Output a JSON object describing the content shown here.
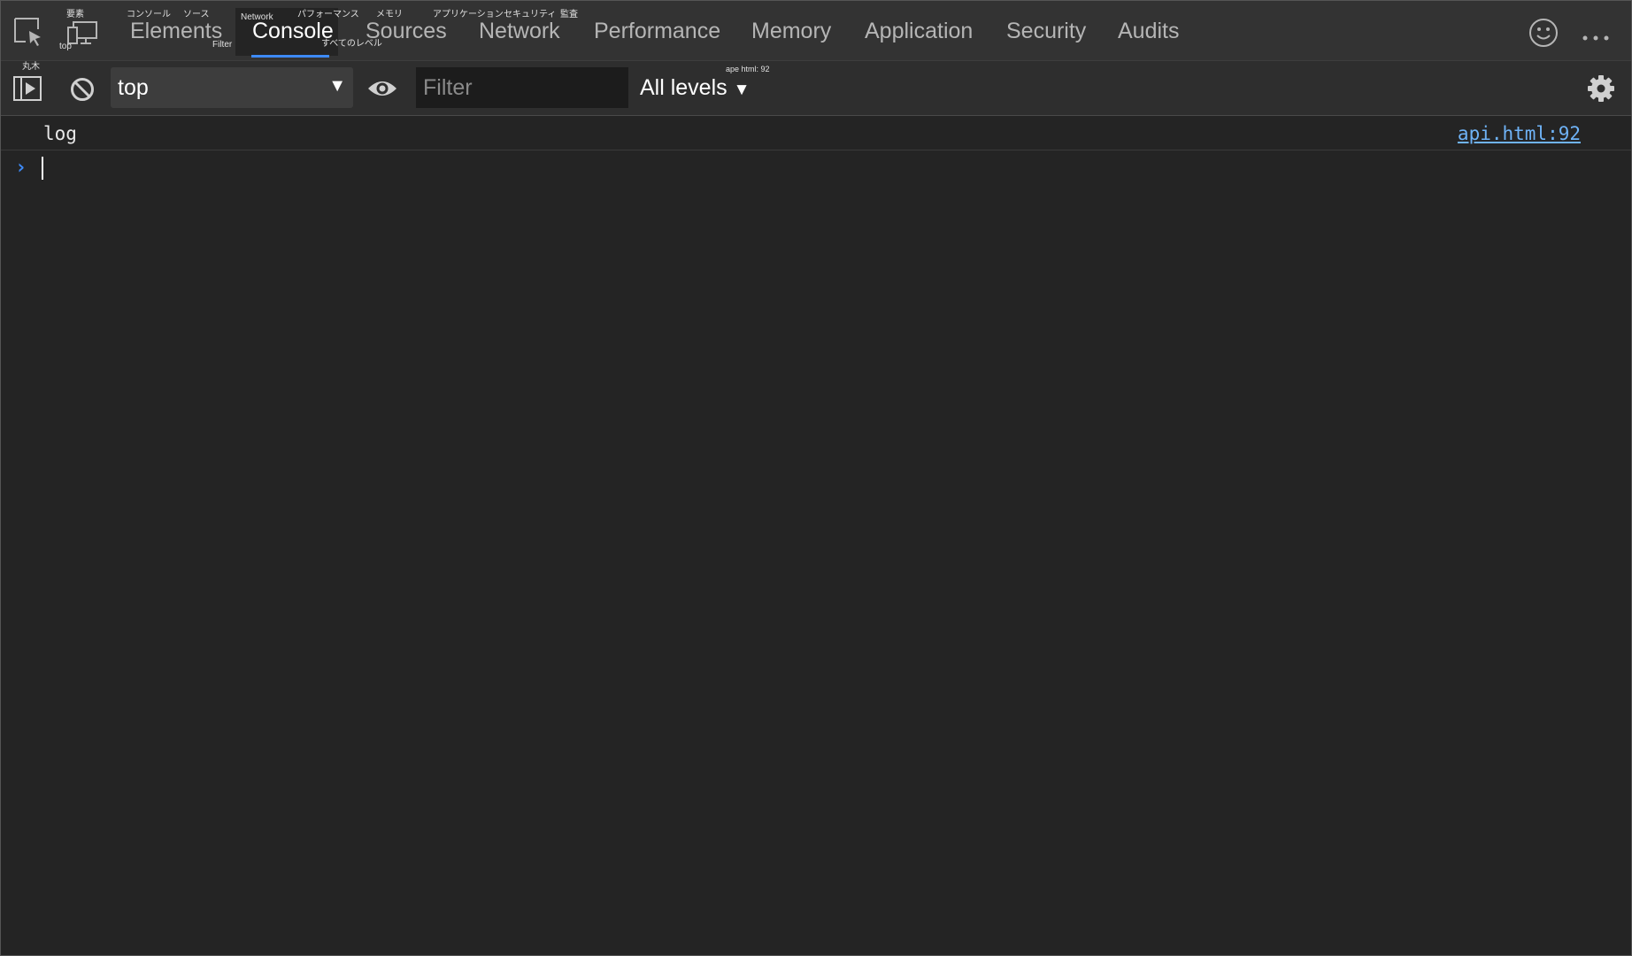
{
  "tabs": [
    {
      "label": "Elements",
      "annotation": "要素"
    },
    {
      "label": "Console",
      "annotation": "Network",
      "active": true
    },
    {
      "label": "Sources",
      "annotation": "ソース"
    },
    {
      "label": "Network",
      "annotation": "メモリ"
    },
    {
      "label": "Performance",
      "annotation": "アプリケーション"
    },
    {
      "label": "Memory",
      "annotation": "セキュリティ"
    },
    {
      "label": "Application",
      "annotation": "監査"
    },
    {
      "label": "Security"
    },
    {
      "label": "Audits"
    }
  ],
  "tabbar_annotations": {
    "console_ja": "コンソール",
    "performance_ja": "パフォーマンス",
    "device_label": "top",
    "filter_label": "Filter",
    "levels_ja": "すべてのレベル"
  },
  "toolbar": {
    "sidebar_annotation": "丸木",
    "context_value": "top",
    "context_arrow": "▼",
    "filter_placeholder": "Filter",
    "levels_label": "All levels",
    "levels_arrow": "▼",
    "levels_annotation": "ape html: 92"
  },
  "console": {
    "entries": [
      {
        "text": "log",
        "source": "api.html:92"
      }
    ],
    "prompt_symbol": "›"
  },
  "colors": {
    "accent": "#3d8af7",
    "link": "#6fb3f7",
    "background": "#242424",
    "tabbar": "#333333"
  },
  "icons": {
    "inspect": "inspect-element-icon",
    "device": "device-toolbar-icon",
    "sidebar": "show-sidebar-icon",
    "clear": "clear-console-icon",
    "eye": "live-expression-eye-icon",
    "feedback": "feedback-smiley-icon",
    "more": "more-options-icon",
    "settings": "settings-gear-icon"
  }
}
